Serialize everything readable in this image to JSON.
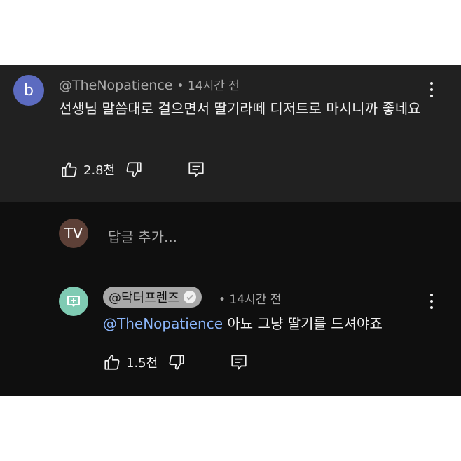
{
  "top_comment": {
    "avatar_letter": "b",
    "avatar_color": "#5c6bc0",
    "author": "@TheNopatience",
    "time": "• 14시간 전",
    "text": "선생님 말씀대로 걸으면서 딸기라떼 디저트로 마시니까 좋네요",
    "like_count": "2.8천"
  },
  "reply_input": {
    "avatar_initials": "TV",
    "avatar_color": "#5d4037",
    "placeholder": "답글 추가..."
  },
  "reply": {
    "avatar_color": "#7fcbb3",
    "author_badge": "@닥터프렌즈",
    "time": "• 14시간 전",
    "mention": "@TheNopatience",
    "text": " 아뇨 그냥 딸기를 드셔야죠",
    "like_count": "1.5천"
  }
}
